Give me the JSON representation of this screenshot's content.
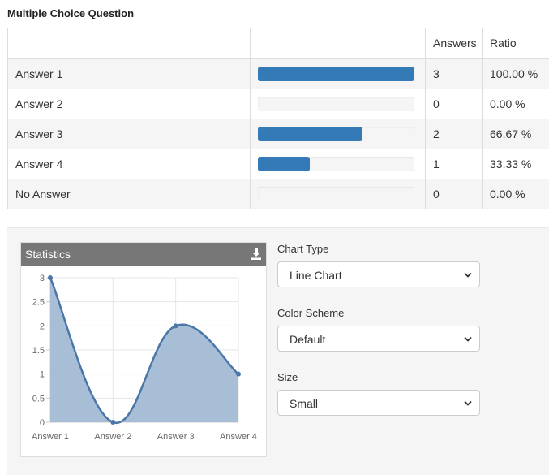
{
  "title": "Multiple Choice Question",
  "table": {
    "headers": [
      "",
      "",
      "Answers",
      "Ratio"
    ],
    "rows": [
      {
        "label": "Answer 1",
        "fraction": 1.0,
        "answers": "3",
        "ratio": "100.00 %"
      },
      {
        "label": "Answer 2",
        "fraction": 0.0,
        "answers": "0",
        "ratio": "0.00 %"
      },
      {
        "label": "Answer 3",
        "fraction": 0.6667,
        "answers": "2",
        "ratio": "66.67 %"
      },
      {
        "label": "Answer 4",
        "fraction": 0.3333,
        "answers": "1",
        "ratio": "33.33 %"
      },
      {
        "label": "No Answer",
        "fraction": 0.0,
        "answers": "0",
        "ratio": "0.00 %"
      }
    ]
  },
  "statistics": {
    "title": "Statistics",
    "download_icon": "download-icon"
  },
  "controls": {
    "chart_type_label": "Chart Type",
    "chart_type_value": "Line Chart",
    "color_scheme_label": "Color Scheme",
    "color_scheme_value": "Default",
    "size_label": "Size",
    "size_value": "Small"
  },
  "colors": {
    "bar": "#337ab7",
    "line": "#4a77a8",
    "area": "#a3bbd4"
  },
  "chart_data": {
    "type": "area",
    "categories": [
      "Answer 1",
      "Answer 2",
      "Answer 3",
      "Answer 4"
    ],
    "values": [
      3,
      0,
      2,
      1
    ],
    "ylim": [
      0,
      3
    ],
    "yticks": [
      "0",
      "0.5",
      "1",
      "1.5",
      "2",
      "2.5",
      "3"
    ],
    "grid": true,
    "legend": "none"
  }
}
